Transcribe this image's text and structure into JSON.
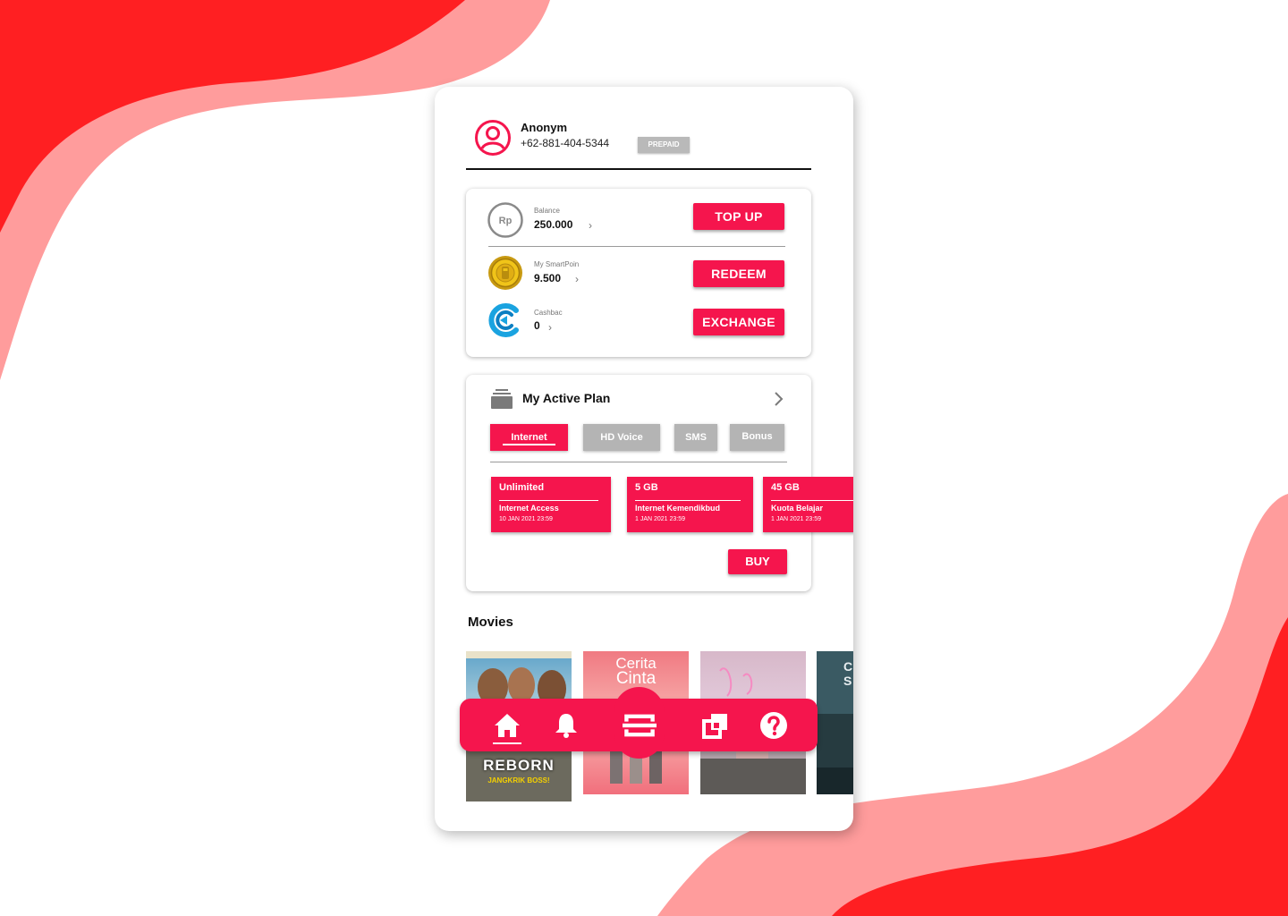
{
  "profile": {
    "name": "Anonym",
    "phone": "+62-881-404-5344",
    "badge": "PREPAID"
  },
  "wallet": {
    "balance": {
      "icon_text": "Rp",
      "label": "Balance",
      "value": "250.000",
      "action": "TOP UP"
    },
    "smartpoin": {
      "label": "My SmartPoin",
      "value": "9.500",
      "action": "REDEEM"
    },
    "cashback": {
      "label": "Cashbac",
      "value": "0",
      "action": "EXCHANGE"
    }
  },
  "active_plan": {
    "title": "My Active Plan",
    "tabs": [
      {
        "label": "Internet",
        "active": true
      },
      {
        "label": "HD Voice",
        "active": false
      },
      {
        "label": "SMS",
        "active": false
      },
      {
        "label": "Bonus",
        "active": false
      }
    ],
    "quotas": [
      {
        "amount": "Unlimited",
        "name": "Internet Access",
        "expiry": "10 JAN 2021 23:59"
      },
      {
        "amount": "5 GB",
        "name": "Internet Kemendikbud",
        "expiry": "1 JAN 2021 23:59"
      },
      {
        "amount": "45 GB",
        "name": "Kuota Belajar",
        "expiry": "1 JAN 2021 23:59"
      }
    ],
    "buy_label": "BUY"
  },
  "movies": {
    "title": "Movies",
    "posters": [
      {
        "caption": "REBORN",
        "subcaption": "JANGKRIK BOSS!"
      },
      {
        "caption": "Cerita",
        "subcaption": "Cinta"
      },
      {
        "caption": "",
        "subcaption": ""
      },
      {
        "caption": "",
        "subcaption": ""
      }
    ]
  },
  "nav": {
    "items": [
      "home-icon",
      "bell-icon",
      "scan-icon",
      "layers-icon",
      "help-icon"
    ],
    "active": "home-icon"
  },
  "colors": {
    "accent": "#f5154d",
    "bg_red": "#ff1f22",
    "bg_pink": "#ff9c9c",
    "muted": "#b4b4b4"
  }
}
